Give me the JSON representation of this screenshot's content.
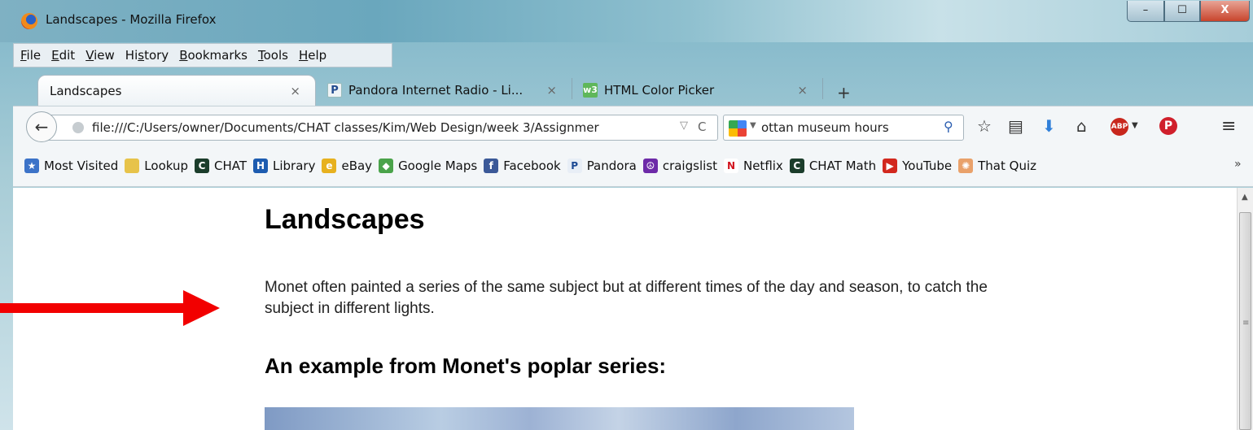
{
  "window": {
    "title": "Landscapes - Mozilla Firefox",
    "min": "–",
    "max": "☐",
    "close": "X"
  },
  "menu": [
    "File",
    "Edit",
    "View",
    "History",
    "Bookmarks",
    "Tools",
    "Help"
  ],
  "tabs": [
    {
      "label": "Landscapes",
      "close": "×"
    },
    {
      "icon_text": "P",
      "label": "Pandora Internet Radio - Li...",
      "close": "×"
    },
    {
      "icon_text": "w3",
      "label": "HTML Color Picker",
      "close": "×"
    }
  ],
  "new_tab": "+",
  "nav": {
    "url": "file:///C:/Users/owner/Documents/CHAT classes/Kim/Web Design/week 3/Assignmer",
    "search_value": "ottan museum hours"
  },
  "toolbar_icons": [
    "back-icon",
    "bookmark-star-icon",
    "reading-list-icon",
    "downloads-icon",
    "home-icon",
    "adblock-plus-icon",
    "pinterest-icon",
    "hamburger-menu-icon"
  ],
  "bookmarks": [
    {
      "label": "Most Visited",
      "icon": "most-visited-icon",
      "color": "#3c73c8",
      "glyph": "★"
    },
    {
      "label": "Lookup",
      "icon": "folder-icon",
      "color": "#e7c34a",
      "glyph": ""
    },
    {
      "label": "CHAT",
      "icon": "chat-icon",
      "color": "#1b3d2b",
      "glyph": "C"
    },
    {
      "label": "Library",
      "icon": "library-icon",
      "color": "#1d5cb0",
      "glyph": "H"
    },
    {
      "label": "eBay",
      "icon": "ebay-icon",
      "color": "#e7b11f",
      "glyph": "e"
    },
    {
      "label": "Google Maps",
      "icon": "google-maps-icon",
      "color": "#4aa34a",
      "glyph": "◆"
    },
    {
      "label": "Facebook",
      "icon": "facebook-icon",
      "color": "#3b5998",
      "glyph": "f"
    },
    {
      "label": "Pandora",
      "icon": "pandora-icon",
      "color": "#e8eef6",
      "glyph": "P"
    },
    {
      "label": "craigslist",
      "icon": "peace-icon",
      "color": "#6d2aa8",
      "glyph": "☮"
    },
    {
      "label": "Netflix",
      "icon": "netflix-icon",
      "color": "#ffffff",
      "glyph": "N"
    },
    {
      "label": "CHAT Math",
      "icon": "chat-math-icon",
      "color": "#1b3d2b",
      "glyph": "C"
    },
    {
      "label": "YouTube",
      "icon": "youtube-icon",
      "color": "#d2281e",
      "glyph": "▶"
    },
    {
      "label": "That Quiz",
      "icon": "that-quiz-icon",
      "color": "#e9a16a",
      "glyph": "✺"
    }
  ],
  "page": {
    "heading": "Landscapes",
    "paragraph": "Monet often painted a series of the same subject but at different times of the day and season, to catch the subject in different lights.",
    "subheading": "An example from Monet's poplar series:"
  },
  "annotation": {
    "arrow_color": "#f20000"
  }
}
